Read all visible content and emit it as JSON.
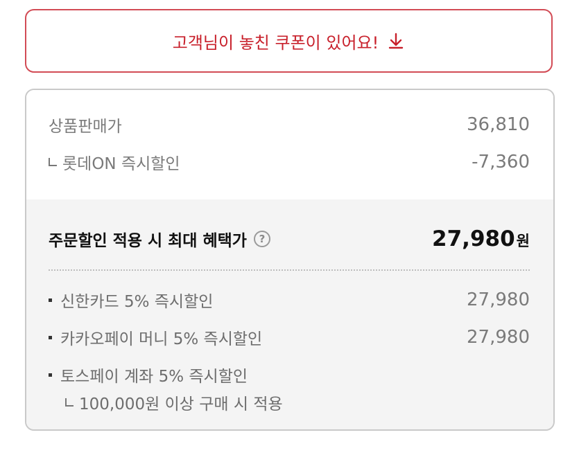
{
  "coupon_banner": {
    "text": "고객님이 놓친 쿠폰이 있어요!",
    "icon": "download-arrow-icon",
    "color": "#c8202b"
  },
  "price": {
    "list_price_label": "상품판매가",
    "list_price_value": "36,810",
    "instant_discount_label": "롯데ON 즉시할인",
    "instant_discount_value": "-7,360",
    "max_benefit_label": "주문할인 적용 시 최대 혜택가",
    "max_benefit_value": "27,980",
    "currency_unit": "원"
  },
  "card_discounts": [
    {
      "label": "신한카드 5% 즉시할인",
      "value": "27,980"
    },
    {
      "label": "카카오페이 머니 5% 즉시할인",
      "value": "27,980"
    },
    {
      "label": "토스페이 계좌 5% 즉시할인",
      "value": ""
    }
  ],
  "toss_condition": "100,000원 이상 구매 시 적용"
}
